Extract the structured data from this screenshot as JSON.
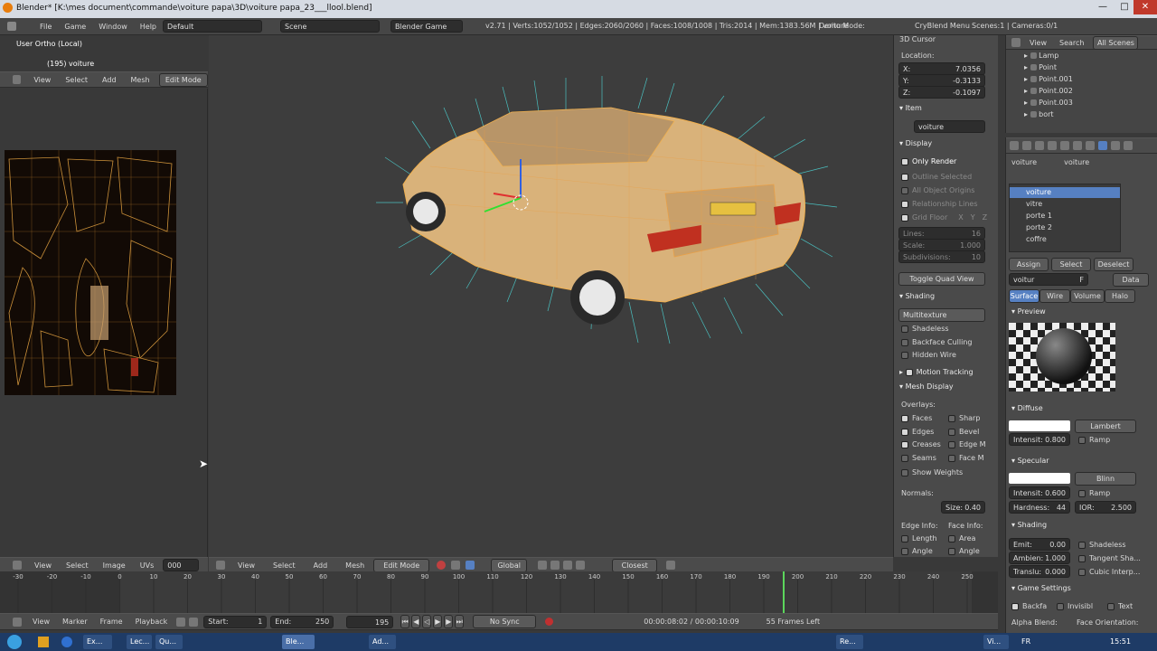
{
  "window": {
    "title": "Blender* [K:\\mes document\\commande\\voiture papa\\3D\\voiture papa_23___llool.blend]",
    "min": "—",
    "max": "□",
    "close": "✕"
  },
  "info": {
    "menus": [
      "File",
      "Game",
      "Window",
      "Help"
    ],
    "layout": "Default",
    "scene": "Scene",
    "engine": "Blender Game",
    "stats": "v2.71 | Verts:1052/1052 | Edges:2060/2060 | Faces:1008/1008 | Tris:2014 | Mem:1383.56M | voiture",
    "demo_mode": "Demo Mode:",
    "crymenu": "CryBlend Menu",
    "scenes": "Scenes:1 | Cameras:0/1"
  },
  "uv": {
    "view_label": "User Ortho (Local)",
    "frame_label": "(195) voiture",
    "menus": [
      "View",
      "Select",
      "Add",
      "Mesh"
    ],
    "mode": "Edit Mode",
    "bottom_menus": [
      "View",
      "Select",
      "Image",
      "UVs"
    ],
    "image_field": "000"
  },
  "viewport": {
    "bottom_menus": [
      "View",
      "Select",
      "Add",
      "Mesh"
    ],
    "mode": "Edit Mode",
    "orientation": "Global",
    "snap": "Closest"
  },
  "npanel": {
    "cursor_title": "3D Cursor",
    "location_label": "Location:",
    "x_label": "X:",
    "x": "7.0356",
    "y_label": "Y:",
    "y": "-0.3133",
    "z_label": "Z:",
    "z": "-0.1097",
    "item_title": "Item",
    "item_name": "voiture",
    "display_title": "Display",
    "only_render": "Only Render",
    "outline": "Outline Selected",
    "all_edges": "All Object Origins",
    "rel_lines": "Relationship Lines",
    "grid_floor": "Grid Floor",
    "grid_x": "X",
    "grid_y": "Y",
    "grid_z": "Z",
    "lines_label": "Lines:",
    "lines": "16",
    "scale_label": "Scale:",
    "scale": "1.000",
    "subdiv_label": "Subdivisions:",
    "subdiv": "10",
    "toggle_quad": "Toggle Quad View",
    "shading_title": "Shading",
    "shading_mode": "Multitexture",
    "shadeless": "Shadeless",
    "backface": "Backface Culling",
    "hidden_wire": "Hidden Wire",
    "motion_tracking": "Motion Tracking",
    "mesh_display": "Mesh Display",
    "overlays": "Overlays:",
    "faces": "Faces",
    "sharp": "Sharp",
    "edges": "Edges",
    "bevel": "Bevel",
    "creases": "Creases",
    "edge_m": "Edge M",
    "seams": "Seams",
    "face_m": "Face M",
    "show_weights": "Show Weights",
    "normals": "Normals:",
    "size_label": "Size:",
    "size": "0.40",
    "edge_info": "Edge Info:",
    "face_info": "Face Info:",
    "length": "Length",
    "area": "Area",
    "angle": "Angle",
    "angle2": "Angle"
  },
  "outliner": {
    "menus": [
      "View",
      "Search"
    ],
    "filter": "All Scenes",
    "items": [
      "Lamp",
      "Point",
      "Point.001",
      "Point.002",
      "Point.003",
      "bort"
    ]
  },
  "props": {
    "crumb1": "voiture",
    "crumb2": "voiture",
    "materials": [
      "voiture",
      "vitre",
      "porte 1",
      "porte 2",
      "coffre"
    ],
    "assign": "Assign",
    "select": "Select",
    "deselect": "Deselect",
    "mat_name": "voitur",
    "mat_users": "F",
    "data": "Data",
    "tabs": [
      "Surface",
      "Wire",
      "Volume",
      "Halo"
    ],
    "preview": "Preview",
    "diffuse": "Diffuse",
    "diffuse_shader": "Lambert",
    "intensity_label": "Intensit:",
    "diff_int": "0.800",
    "ramp": "Ramp",
    "specular": "Specular",
    "spec_shader": "Blinn",
    "spec_int": "0.600",
    "hardness_label": "Hardness:",
    "hardness": "44",
    "ior_label": "IOR:",
    "ior": "2.500",
    "shading": "Shading",
    "emit_label": "Emit:",
    "emit": "0.00",
    "ambient_label": "Ambien:",
    "ambient": "1.000",
    "transl_label": "Translu:",
    "transl": "0.000",
    "shadeless": "Shadeless",
    "tangent": "Tangent Sha...",
    "cubic": "Cubic Interp...",
    "game_settings": "Game Settings",
    "backface": "Backfa",
    "invisible": "Invisibl",
    "text": "Text",
    "alpha_blend": "Alpha Blend:",
    "face_orient": "Face Orientation:"
  },
  "timeline": {
    "ticks": [
      "-30",
      "-20",
      "-10",
      "0",
      "10",
      "20",
      "30",
      "40",
      "50",
      "60",
      "70",
      "80",
      "90",
      "100",
      "110",
      "120",
      "130",
      "140",
      "150",
      "160",
      "170",
      "180",
      "190",
      "200",
      "210",
      "220",
      "230",
      "240",
      "250"
    ],
    "menus": [
      "View",
      "Marker",
      "Frame",
      "Playback"
    ],
    "start_label": "Start:",
    "start": "1",
    "end_label": "End:",
    "end": "250",
    "current": "195",
    "sync": "No Sync",
    "time": "00:00:08:02 / 00:00:10:09",
    "frames_left": "55 Frames Left"
  },
  "taskbar": {
    "items": [
      "Ex...",
      "Lec...",
      "Qu...",
      "Ble...",
      "Ad...",
      "Re...",
      "Vi..."
    ],
    "lang": "FR",
    "clock": "15:51"
  },
  "colors": {
    "accent": "#5680c2",
    "uv_wire": "#e0a040",
    "normals": "#4dd6d6"
  }
}
